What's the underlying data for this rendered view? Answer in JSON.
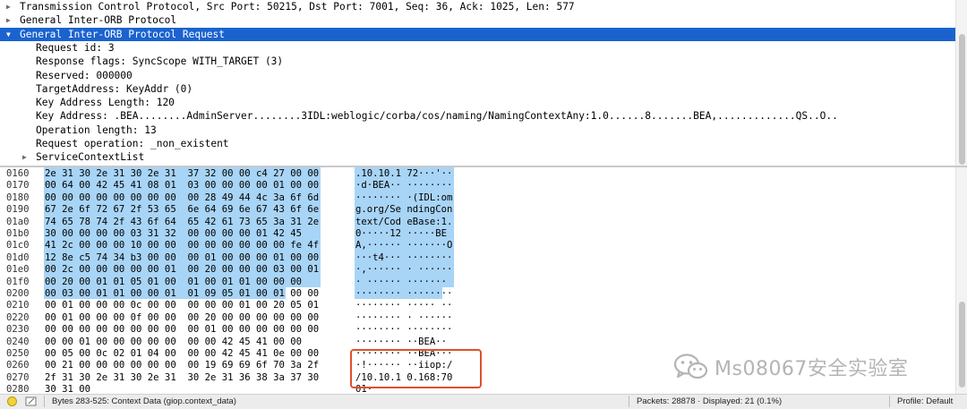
{
  "tree": {
    "rows": [
      {
        "label": "Transmission Control Protocol, Src Port: 50215, Dst Port: 7001, Seq: 36, Ack: 1025, Len: 577",
        "indent": 0,
        "arrow": "▶",
        "selected": false
      },
      {
        "label": "General Inter-ORB Protocol",
        "indent": 0,
        "arrow": "▶",
        "selected": false
      },
      {
        "label": "General Inter-ORB Protocol Request",
        "indent": 0,
        "arrow": "▼",
        "selected": true
      },
      {
        "label": "Request id: 3",
        "indent": 2,
        "arrow": "",
        "selected": false
      },
      {
        "label": "Response flags: SyncScope WITH_TARGET (3)",
        "indent": 2,
        "arrow": "",
        "selected": false
      },
      {
        "label": "Reserved: 000000",
        "indent": 2,
        "arrow": "",
        "selected": false
      },
      {
        "label": "TargetAddress: KeyAddr (0)",
        "indent": 2,
        "arrow": "",
        "selected": false
      },
      {
        "label": "Key Address Length: 120",
        "indent": 2,
        "arrow": "",
        "selected": false
      },
      {
        "label": "Key Address: .BEA........AdminServer........3IDL:weblogic/corba/cos/naming/NamingContextAny:1.0......8.......BEA,.............QS..O..",
        "indent": 2,
        "arrow": "",
        "selected": false
      },
      {
        "label": "Operation length: 13",
        "indent": 2,
        "arrow": "",
        "selected": false
      },
      {
        "label": "Request operation: _non_existent",
        "indent": 2,
        "arrow": "",
        "selected": false
      },
      {
        "label": "ServiceContextList",
        "indent": 2,
        "arrow": "▶",
        "selected": false
      }
    ]
  },
  "hex": {
    "rows": [
      {
        "offset": "0160",
        "bytes": "2e 31 30 2e 31 30 2e 31  37 32 00 00 c4 27 00 00",
        "ascii": ".10.10.1 72···'··",
        "hl": 16
      },
      {
        "offset": "0170",
        "bytes": "00 64 00 42 45 41 08 01  03 00 00 00 00 01 00 00",
        "ascii": "·d·BEA·· ········",
        "hl": 16
      },
      {
        "offset": "0180",
        "bytes": "00 00 00 00 00 00 00 00  00 28 49 44 4c 3a 6f 6d",
        "ascii": "········ ·(IDL:om",
        "hl": 16
      },
      {
        "offset": "0190",
        "bytes": "67 2e 6f 72 67 2f 53 65  6e 64 69 6e 67 43 6f 6e",
        "ascii": "g.org/Se ndingCon",
        "hl": 16
      },
      {
        "offset": "01a0",
        "bytes": "74 65 78 74 2f 43 6f 64  65 42 61 73 65 3a 31 2e",
        "ascii": "text/Cod eBase:1.",
        "hl": 16
      },
      {
        "offset": "01b0",
        "bytes": "30 00 00 00 00 03 31 32  00 00 00 00 01 42 45",
        "ascii": "0·····12 ·····BE",
        "hl": 16
      },
      {
        "offset": "01c0",
        "bytes": "41 2c 00 00 00 10 00 00  00 00 00 00 00 00 fe 4f",
        "ascii": "A,······ ·······O",
        "hl": 16
      },
      {
        "offset": "01d0",
        "bytes": "12 8e c5 74 34 b3 00 00  00 01 00 00 00 01 00 00",
        "ascii": "···t4··· ········",
        "hl": 16
      },
      {
        "offset": "01e0",
        "bytes": "00 2c 00 00 00 00 00 01  00 20 00 00 00 03 00 01",
        "ascii": "·,······ · ······",
        "hl": 16
      },
      {
        "offset": "01f0",
        "bytes": "00 20 00 01 01 05 01 00  01 00 01 01 00 00 00",
        "ascii": "· ······ ·······",
        "hl": 16
      },
      {
        "offset": "0200",
        "bytes": "00 03 00 01 01 00 00 01  01 09 05 01 00 01 00 00",
        "ascii": "········ ········",
        "hl": 14
      },
      {
        "offset": "0210",
        "bytes": "00 01 00 00 00 0c 00 00  00 00 00 01 00 20 05 01",
        "ascii": "········ ····· ··",
        "hl": 0
      },
      {
        "offset": "0220",
        "bytes": "00 01 00 00 00 0f 00 00  00 20 00 00 00 00 00 00",
        "ascii": "········ · ······",
        "hl": 0
      },
      {
        "offset": "0230",
        "bytes": "00 00 00 00 00 00 00 00  00 01 00 00 00 00 00 00",
        "ascii": "········ ········",
        "hl": 0
      },
      {
        "offset": "0240",
        "bytes": "00 00 01 00 00 00 00 00  00 00 42 45 41 00 00",
        "ascii": "········ ··BEA··",
        "hl": 0
      },
      {
        "offset": "0250",
        "bytes": "00 05 00 0c 02 01 04 00  00 00 42 45 41 0e 00 00",
        "ascii": "········ ··BEA···",
        "hl": 0
      },
      {
        "offset": "0260",
        "bytes": "00 21 00 00 00 00 00 00  00 19 69 69 6f 70 3a 2f",
        "ascii": "·!······ ··iiop:/",
        "hl": 0
      },
      {
        "offset": "0270",
        "bytes": "2f 31 30 2e 31 30 2e 31  30 2e 31 36 38 3a 37 30",
        "ascii": "/10.10.1 0.168:70",
        "hl": 0
      },
      {
        "offset": "0280",
        "bytes": "30 31 00",
        "ascii": "01·",
        "hl": 0
      }
    ]
  },
  "watermark": {
    "text": "Ms08067安全实验室"
  },
  "status": {
    "bytes_info": "Bytes 283-525: Context Data (giop.context_data)",
    "packets": "Packets: 28878 · Displayed: 21 (0.1%)",
    "profile": "Profile: Default"
  },
  "colors": {
    "selection": "#1a63cf",
    "hex_highlight": "#a8d4f6",
    "callout_border": "#e0502a"
  }
}
